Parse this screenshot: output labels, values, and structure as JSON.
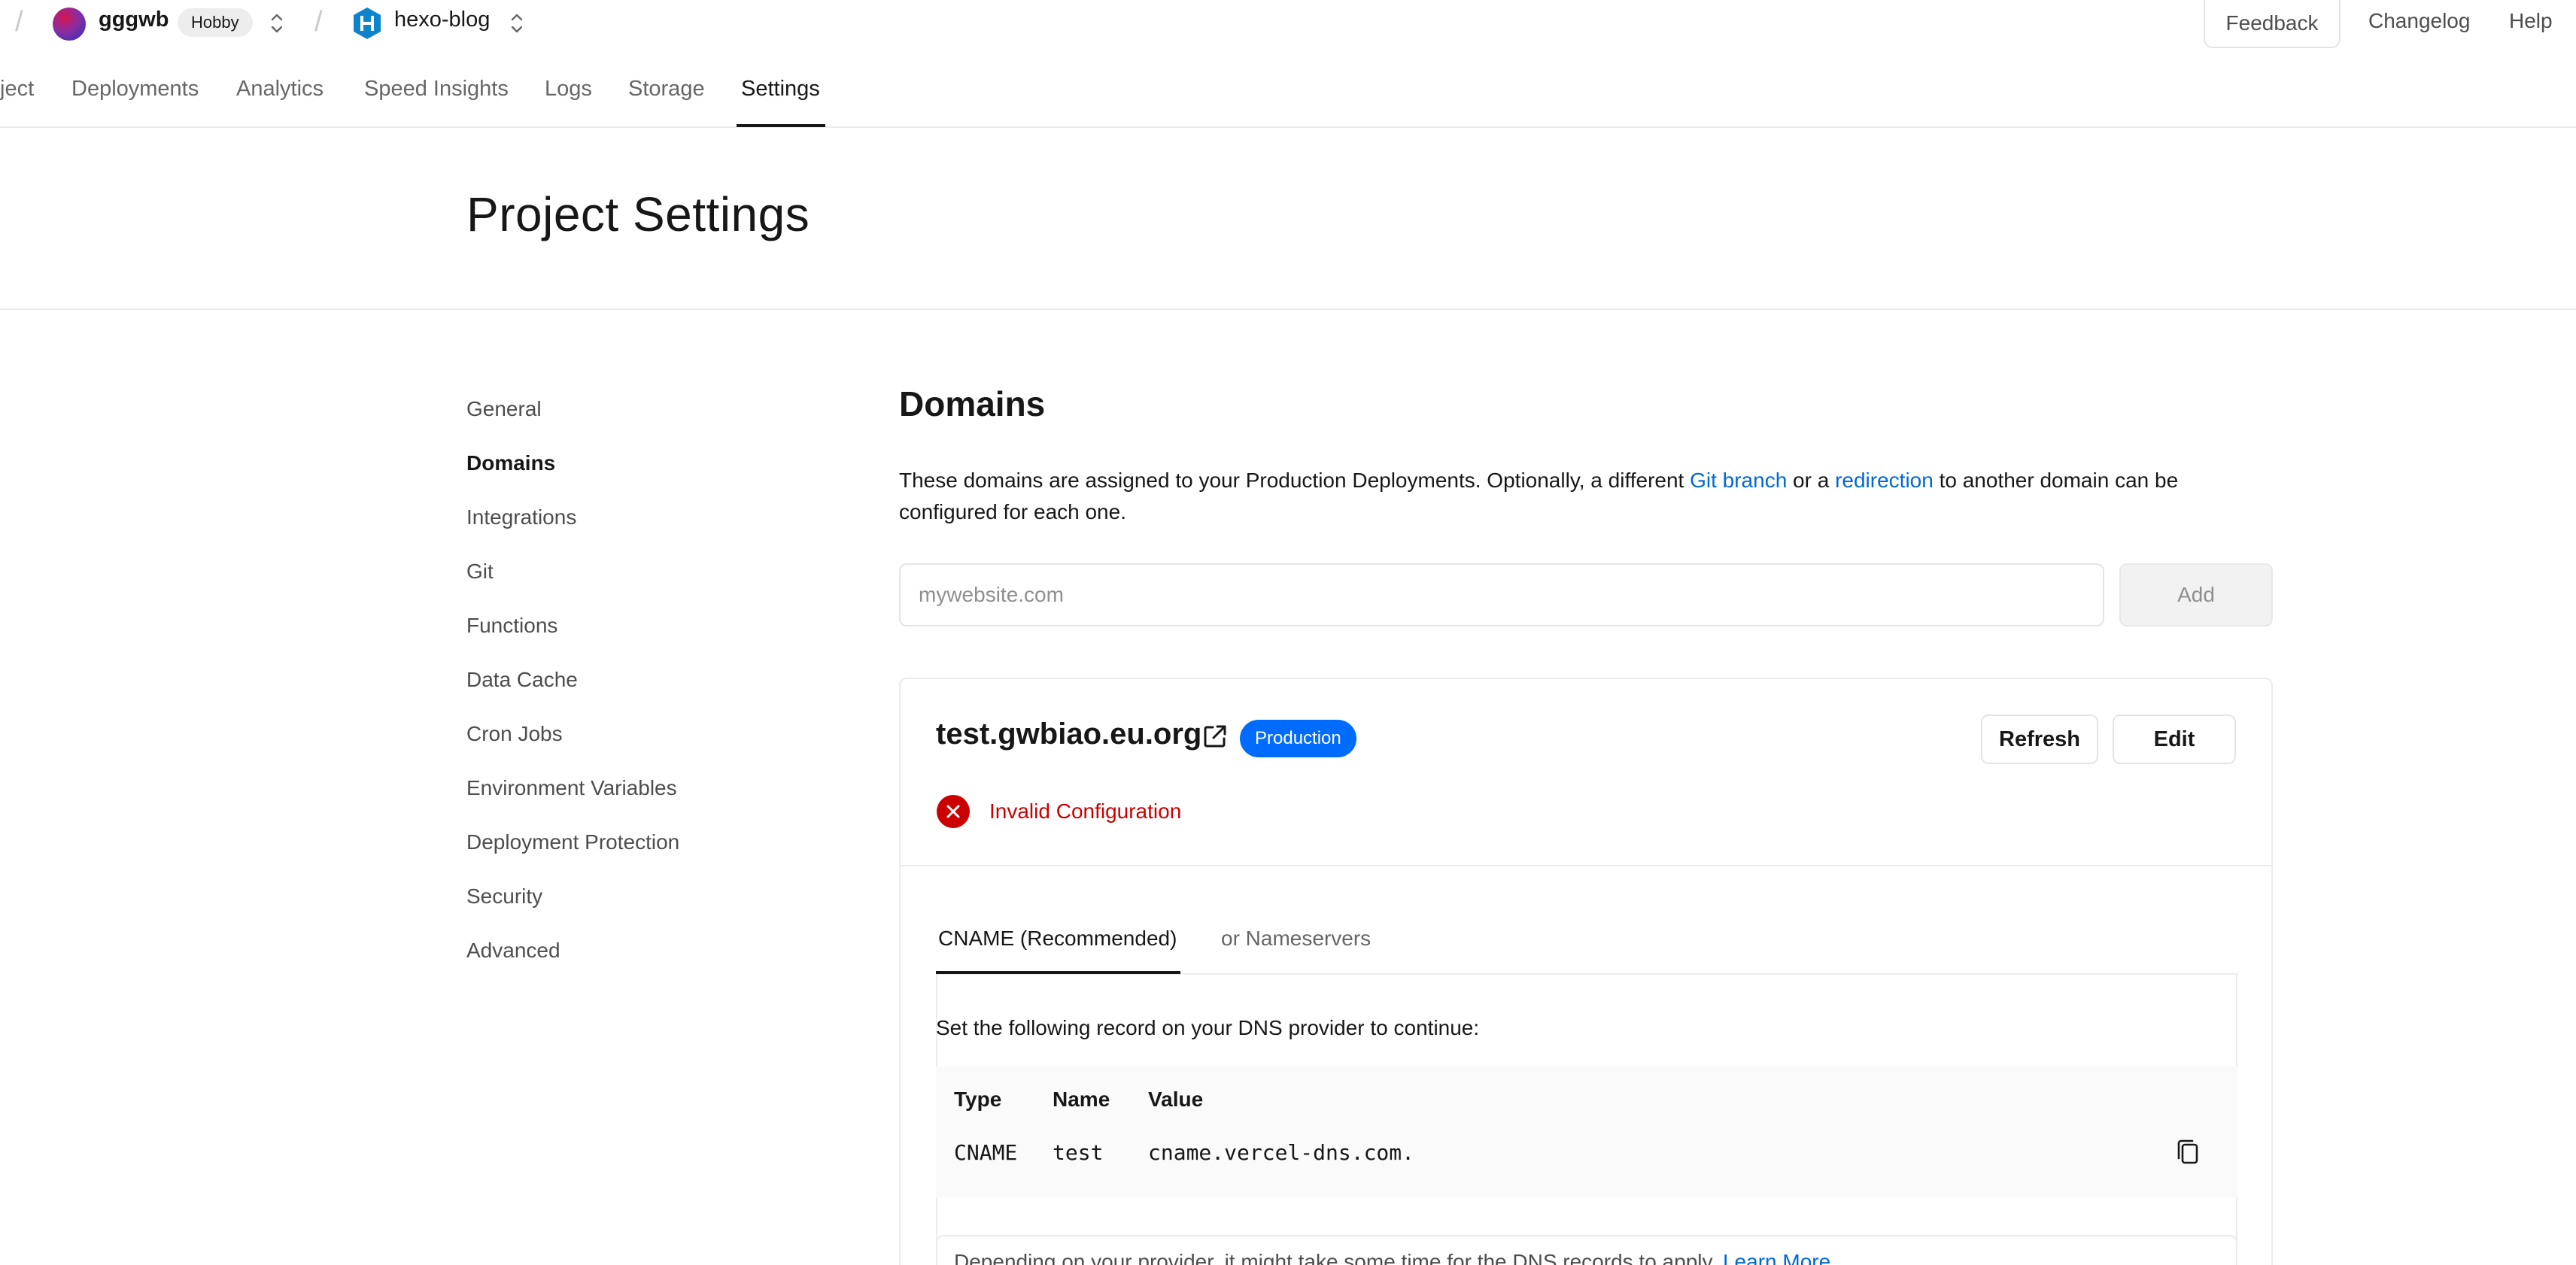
{
  "topbar": {
    "team_name": "gggwb",
    "plan_badge": "Hobby",
    "project_name": "hexo-blog",
    "feedback": "Feedback",
    "changelog": "Changelog",
    "help": "Help"
  },
  "tabs": [
    "ject",
    "Deployments",
    "Analytics",
    "Speed Insights",
    "Logs",
    "Storage",
    "Settings"
  ],
  "header": {
    "title": "Project Settings"
  },
  "sidenav": [
    "General",
    "Domains",
    "Integrations",
    "Git",
    "Functions",
    "Data Cache",
    "Cron Jobs",
    "Environment Variables",
    "Deployment Protection",
    "Security",
    "Advanced"
  ],
  "domains": {
    "title": "Domains",
    "desc_1": "These domains are assigned to your Production Deployments. Optionally, a different ",
    "link_git_branch": "Git branch",
    "desc_2": " or a ",
    "link_redirection": "redirection",
    "desc_3": " to another domain can be configured for each one.",
    "input_placeholder": "mywebsite.com",
    "add_label": "Add",
    "card": {
      "domain": "test.gwbiao.eu.org",
      "badge": "Production",
      "refresh": "Refresh",
      "edit": "Edit",
      "status": "Invalid Configuration",
      "tab_cname": "CNAME (Recommended)",
      "tab_ns": "or Nameservers",
      "instruction": "Set the following record on your DNS provider to continue:",
      "headers": [
        "Type",
        "Name",
        "Value"
      ],
      "record": [
        "CNAME",
        "test",
        "cname.vercel-dns.com."
      ],
      "notice": "Depending on your provider, it might take some time for the DNS records to apply. ",
      "learn_more": "Learn More"
    }
  },
  "colors": {
    "accent_blue": "#0068d6",
    "badge_blue": "#006bff",
    "error_red": "#cb0000"
  }
}
